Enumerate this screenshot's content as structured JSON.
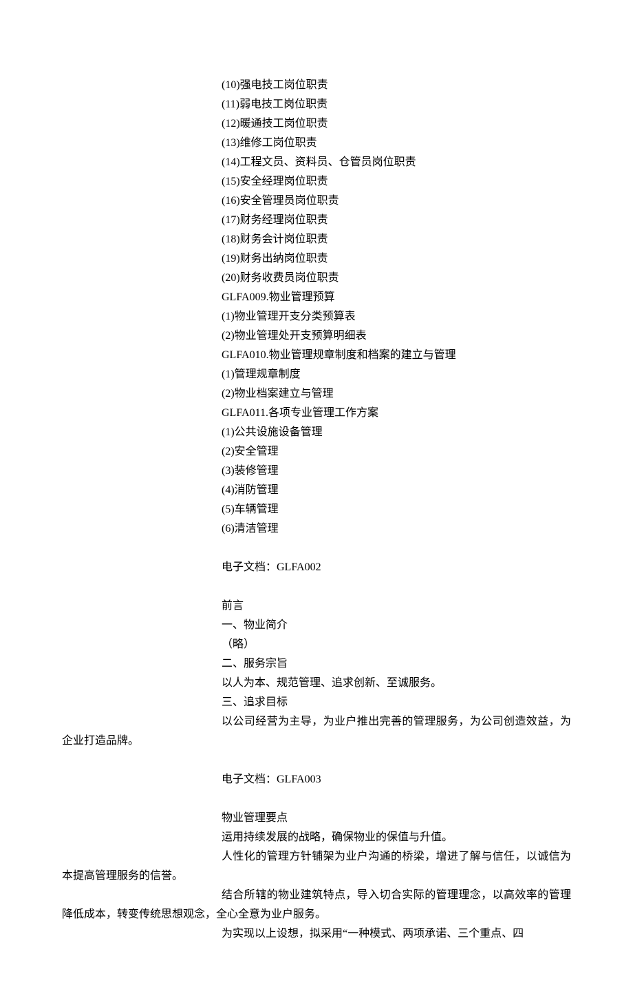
{
  "items": [
    "(10)强电技工岗位职责",
    "(11)弱电技工岗位职责",
    "(12)暖通技工岗位职责",
    "(13)维修工岗位职责",
    "(14)工程文员、资料员、仓管员岗位职责",
    "(15)安全经理岗位职责",
    "(16)安全管理员岗位职责",
    "(17)财务经理岗位职责",
    "(18)财务会计岗位职责",
    "(19)财务出纳岗位职责",
    "(20)财务收费员岗位职责"
  ],
  "glfa009": {
    "title": "GLFA009.物业管理预算",
    "items": [
      "(1)物业管理开支分类预算表",
      "(2)物业管理处开支预算明细表"
    ]
  },
  "glfa010": {
    "title": "GLFA010.物业管理规章制度和档案的建立与管理",
    "items": [
      "(1)管理规章制度",
      "(2)物业档案建立与管理"
    ]
  },
  "glfa011": {
    "title": "GLFA011.各项专业管理工作方案",
    "items": [
      "(1)公共设施设备管理",
      "(2)安全管理",
      "(3)装修管理",
      "(4)消防管理",
      "(5)车辆管理",
      "(6)清洁管理"
    ]
  },
  "doc002": {
    "header": "电子文档：GLFA002",
    "title": "前言",
    "sec1_title": "一、物业简介",
    "sec1_body": "（略）",
    "sec2_title": "二、服务宗旨",
    "sec2_body": "以人为本、规范管理、追求创新、至诚服务。",
    "sec3_title": "三、追求目标",
    "sec3_body": "以公司经营为主导，为业户推出完善的管理服务，为公司创造效益，为企业打造品牌。"
  },
  "doc003": {
    "header": "电子文档：GLFA003",
    "title": "物业管理要点",
    "p1": "运用持续发展的战略，确保物业的保值与升值。",
    "p2": "人性化的管理方针铺架为业户沟通的桥梁，增进了解与信任，以诚信为本提高管理服务的信誉。",
    "p3": "结合所辖的物业建筑特点，导入切合实际的管理理念，以高效率的管理降低成本，转变传统思想观念，全心全意为业户服务。",
    "p4": "为实现以上设想，拟采用“一种模式、两项承诺、三个重点、四"
  }
}
